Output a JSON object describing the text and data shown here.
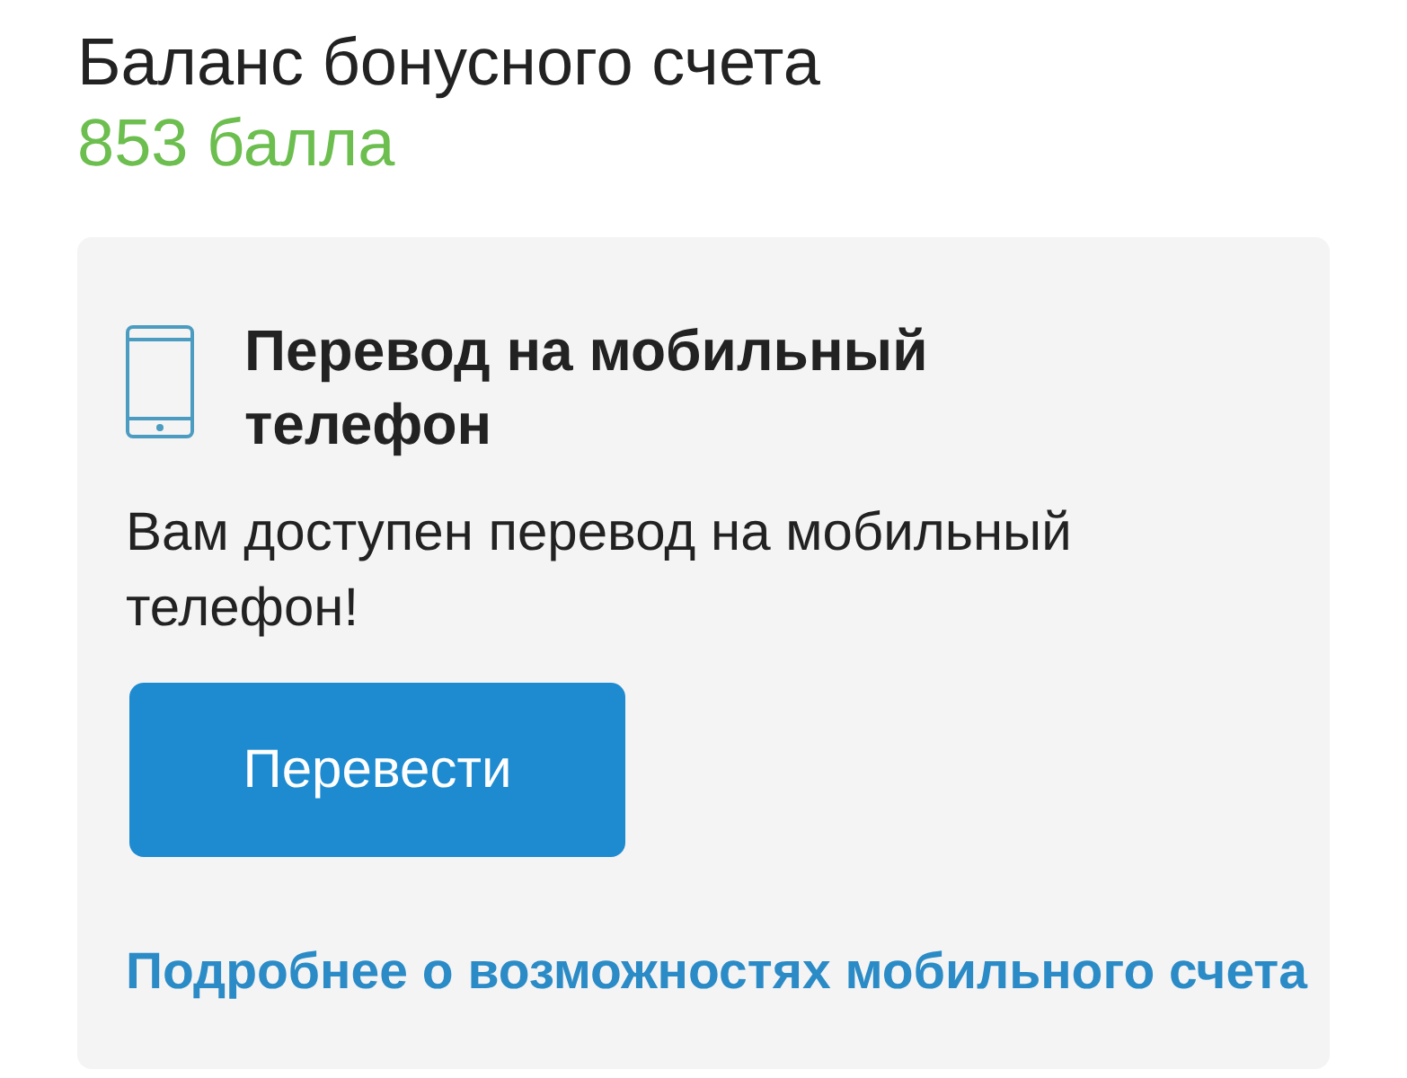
{
  "balance": {
    "title": "Баланс бонусного счета",
    "value": "853 балла"
  },
  "transfer_card": {
    "title": "Перевод на мобильный телефон",
    "text": "Вам доступен перевод на мобильный телефон!",
    "button": "Перевести",
    "link": "Подробнее о возможностях мобильного счета"
  }
}
